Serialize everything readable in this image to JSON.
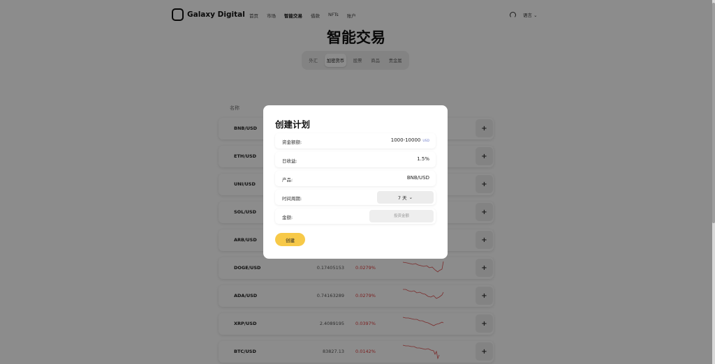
{
  "brand": {
    "name": "Galaxy Digital"
  },
  "nav": {
    "links": [
      "首页",
      "市场",
      "智能交易",
      "借款",
      "NFTs",
      "账户"
    ],
    "active_index": 2,
    "language_label": "语言"
  },
  "hero_title": "智能交易",
  "tabs": {
    "items": [
      "外汇",
      "加密货币",
      "股票",
      "商品",
      "贵金属"
    ],
    "active_index": 1
  },
  "list": {
    "column_name": "名称",
    "add_icon": "+",
    "rows": [
      {
        "symbol": "BNB/USD",
        "price": "",
        "change": ""
      },
      {
        "symbol": "ETH/USD",
        "price": "",
        "change": ""
      },
      {
        "symbol": "UNI/USD",
        "price": "",
        "change": ""
      },
      {
        "symbol": "SOL/USD",
        "price": "",
        "change": ""
      },
      {
        "symbol": "ARB/USD",
        "price": "",
        "change": ""
      },
      {
        "symbol": "DOGE/USD",
        "price": "0.17405153",
        "change": "0.0279%"
      },
      {
        "symbol": "ADA/USD",
        "price": "0.74163289",
        "change": "0.0279%"
      },
      {
        "symbol": "XRP/USD",
        "price": "2.4089195",
        "change": "0.0397%"
      },
      {
        "symbol": "BTC/USD",
        "price": "83827.13",
        "change": "0.0142%"
      }
    ]
  },
  "modal": {
    "title": "创建计划",
    "fund_limit_label": "资金额额:",
    "fund_limit_value": "1000-10000",
    "fund_limit_unit": "USD",
    "daily_return_label": "日收益:",
    "daily_return_value": "1.5%",
    "product_label": "产品:",
    "product_value": "BNB/USD",
    "period_label": "时间周期:",
    "period_value": "7 天",
    "amount_label": "金额:",
    "amount_placeholder": "投资金额",
    "create_label": "创建"
  },
  "colors": {
    "accent": "#f7c948",
    "negative": "#e03a3a",
    "overlay": "rgba(0,0,0,0.45)"
  }
}
